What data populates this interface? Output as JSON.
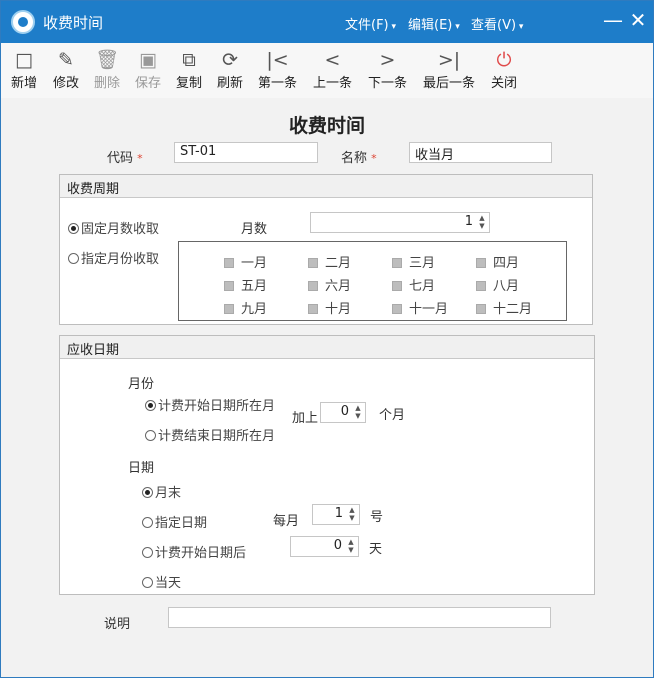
{
  "window": {
    "title": "收费时间"
  },
  "menubar": [
    {
      "label": "文件(F)"
    },
    {
      "label": "编辑(E)"
    },
    {
      "label": "查看(V)"
    }
  ],
  "toolbar": {
    "new": "新增",
    "edit": "修改",
    "delete": "删除",
    "save": "保存",
    "copy": "复制",
    "refresh": "刷新",
    "first": "第一条",
    "prev": "上一条",
    "next": "下一条",
    "last": "最后一条",
    "close": "关闭"
  },
  "form": {
    "title": "收费时间",
    "code_label": "代码",
    "code_value": "ST-01",
    "name_label": "名称",
    "name_value": "收当月",
    "required_mark": "*"
  },
  "period": {
    "header": "收费周期",
    "fixed_label": "固定月数收取",
    "fixed_selected": true,
    "months_label": "月数",
    "months_value": "1",
    "specified_label": "指定月份收取",
    "specified_selected": false,
    "months": [
      "一月",
      "二月",
      "三月",
      "四月",
      "五月",
      "六月",
      "七月",
      "八月",
      "九月",
      "十月",
      "十一月",
      "十二月"
    ]
  },
  "due": {
    "header": "应收日期",
    "month_heading": "月份",
    "start_month_label": "计费开始日期所在月",
    "start_month_selected": true,
    "end_month_label": "计费结束日期所在月",
    "end_month_selected": false,
    "add_label": "加上",
    "add_value": "0",
    "add_unit": "个月",
    "day_heading": "日期",
    "month_end_label": "月末",
    "month_end_selected": true,
    "specified_day_label": "指定日期",
    "specified_day_selected": false,
    "per_month_label": "每月",
    "per_month_value": "1",
    "per_month_unit": "号",
    "after_start_label": "计费开始日期后",
    "after_start_selected": false,
    "after_value": "0",
    "after_unit": "天",
    "today_label": "当天",
    "today_selected": false
  },
  "remark": {
    "label": "说明",
    "value": ""
  }
}
